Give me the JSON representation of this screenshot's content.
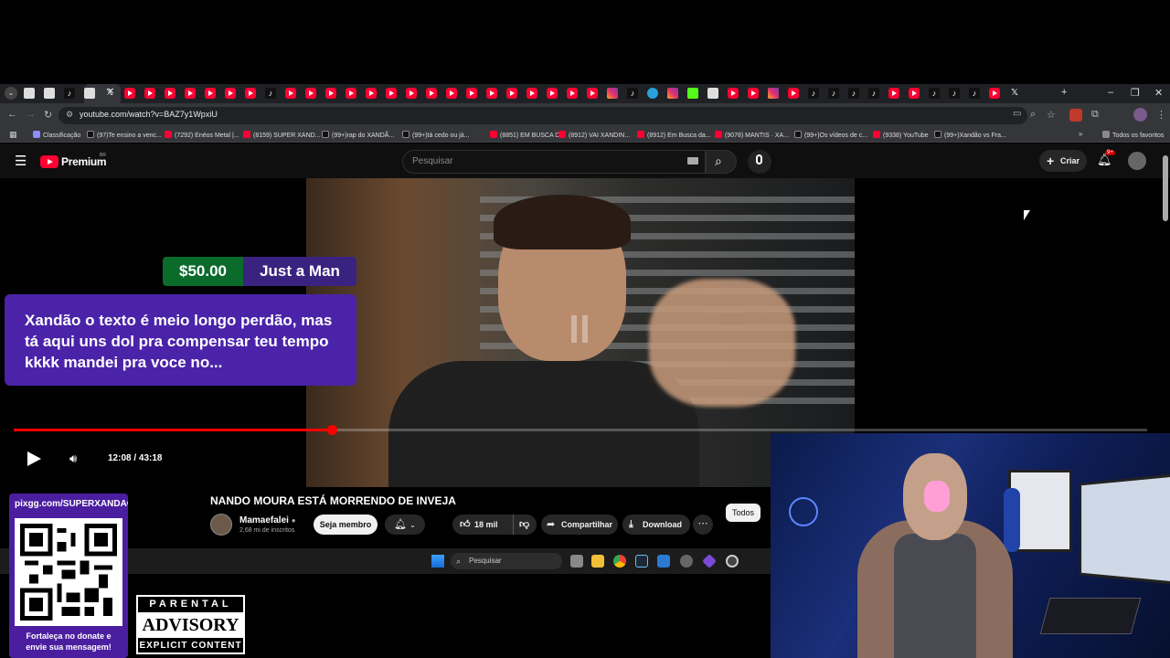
{
  "browser": {
    "url": "youtube.com/watch?v=BAZ7y1WpxiU",
    "bookmarks": [
      "Classificação",
      "(97)Te ensino a venc...",
      "(7292) Enéos Metal |...",
      "(8159) SUPER XAND...",
      "(99+)rap do XANDÃ...",
      "(99+)tá cedo ou já...",
      "(8851) EM BUSCA D...",
      "(8912) VAI XANDIN...",
      "(8912) Em Busca da...",
      "(9078) MANTIS · XA...",
      "(99+)Os vídeos de c...",
      "(9338) YouTube",
      "(99+)Xandão vs Fra..."
    ],
    "all_bookmarks": "Todos os favoritos"
  },
  "youtube": {
    "logo_text": "Premium",
    "logo_region": "BR",
    "search_placeholder": "Pesquisar",
    "create_label": "Criar",
    "notifications_badge": "9+"
  },
  "superchat": {
    "amount": "$50.00",
    "name": "Just a Man",
    "message": "Xandão o texto é meio longo perdão, mas tá aqui uns dol pra compensar teu tempo kkkk mandei pra voce no..."
  },
  "player": {
    "current_time": "12:08",
    "duration": "43:18",
    "time_display": "12:08 / 43:18",
    "progress": 0.281
  },
  "video": {
    "title": "NANDO MOURA ESTÁ MORRENDO DE INVEJA",
    "channel": "Mamaefalei",
    "subscribers": "2,68 mi de inscritos",
    "join_label": "Seja membro",
    "likes": "18 mil",
    "share_label": "Compartilhar",
    "download_label": "Download",
    "filter_chip": "Todos"
  },
  "taskbar": {
    "search_placeholder": "Pesquisar"
  },
  "donation": {
    "url": "pixgg.com/SUPERXANDAO",
    "text_line1": "Fortaleça no donate e",
    "text_line2": "envie sua mensagem!"
  },
  "advisory": {
    "top": "PARENTAL",
    "mid": "ADVISORY",
    "bottom": "EXPLICIT CONTENT"
  },
  "colors": {
    "youtube_red": "#ff0033",
    "superchat_green": "#0a6b2b",
    "superchat_purple": "#4a23a8",
    "donation_purple": "#4b1ea0"
  }
}
